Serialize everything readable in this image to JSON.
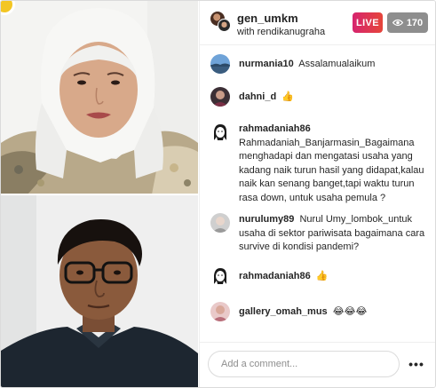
{
  "header": {
    "username": "gen_umkm",
    "subtitle": "with rendikanugraha",
    "live_label": "LIVE",
    "viewer_count": "170"
  },
  "comments": [
    {
      "username": "nurmania10",
      "text": "Assalamualaikum",
      "avatar": "landscape"
    },
    {
      "username": "dahni_d",
      "text": "👍",
      "avatar": "person-dark"
    },
    {
      "username": "rahmadaniah86",
      "text": "Rahmadaniah_Banjarmasin_Bagaimana menghadapi dan mengatasi usaha yang kadang naik turun hasil yang didapat,kalau naik kan senang banget,tapi waktu turun rasa down, untuk usaha pemula ?",
      "avatar": "sketch"
    },
    {
      "username": "nurulumy89",
      "text": "Nurul Umy_lombok_untuk usaha di sektor pariwisata bagaimana cara survive di kondisi pandemi?",
      "avatar": "person-grey"
    },
    {
      "username": "rahmadaniah86",
      "text": "👍",
      "avatar": "sketch"
    },
    {
      "username": "gallery_omah_mus",
      "text": "😂😂😂",
      "avatar": "person-pink"
    }
  ],
  "composer": {
    "placeholder": "Add a comment...",
    "more_label": "•••"
  },
  "colors": {
    "live_gradient_start": "#d6246e",
    "live_gradient_end": "#e6453a",
    "viewer_badge": "#8e8e8e"
  }
}
